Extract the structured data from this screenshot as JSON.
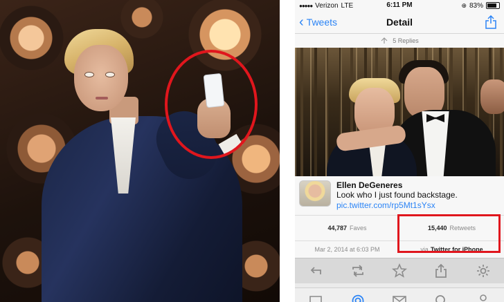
{
  "status_bar": {
    "carrier": "Verizon",
    "network": "LTE",
    "time": "6:11 PM",
    "battery": "83%"
  },
  "nav": {
    "back_label": "Tweets",
    "title": "Detail"
  },
  "replies": "5 Replies",
  "tweet": {
    "author": "Ellen DeGeneres",
    "text": "Look who I just found backstage.",
    "link": "pic.twitter.com/rp5Mt1sYsx"
  },
  "stats": {
    "faves_count": "44,787",
    "faves_label": "Faves",
    "retweets_count": "15,440",
    "retweets_label": "Retweets"
  },
  "meta": {
    "timestamp": "Mar 2, 2014 at 6:03 PM",
    "via_label": "via",
    "client": "Twitter for iPhone"
  },
  "colors": {
    "accent": "#2b84f6",
    "highlight": "#e0161d"
  },
  "icons": {
    "action_bar": [
      "reply-icon",
      "retweet-icon",
      "favorite-star-icon",
      "share-out-icon",
      "settings-gear-icon"
    ],
    "tab_bar": [
      "chat-bubble-icon",
      "mention-at-icon",
      "mail-envelope-icon",
      "search-icon",
      "profile-person-icon"
    ]
  }
}
